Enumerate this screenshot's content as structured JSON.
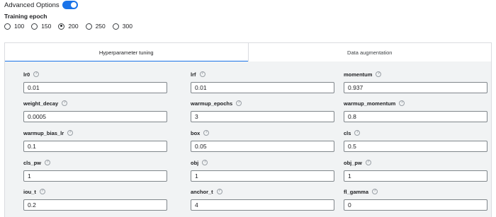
{
  "advanced": {
    "label": "Advanced Options",
    "enabled": true
  },
  "epoch": {
    "title": "Training epoch",
    "options": [
      "100",
      "150",
      "200",
      "250",
      "300"
    ],
    "selected": "200"
  },
  "tabs": [
    {
      "label": "Hyperparameter tuning",
      "active": true
    },
    {
      "label": "Data augmentation",
      "active": false
    }
  ],
  "help_glyph": "?",
  "fields": [
    {
      "label": "lr0",
      "value": "0.01"
    },
    {
      "label": "lrf",
      "value": "0.01"
    },
    {
      "label": "momentum",
      "value": "0.937"
    },
    {
      "label": "weight_decay",
      "value": "0.0005"
    },
    {
      "label": "warmup_epochs",
      "value": "3"
    },
    {
      "label": "warmup_momentum",
      "value": "0.8"
    },
    {
      "label": "warmup_bias_lr",
      "value": "0.1"
    },
    {
      "label": "box",
      "value": "0.05"
    },
    {
      "label": "cls",
      "value": "0.5"
    },
    {
      "label": "cls_pw",
      "value": "1"
    },
    {
      "label": "obj",
      "value": "1"
    },
    {
      "label": "obj_pw",
      "value": "1"
    },
    {
      "label": "iou_t",
      "value": "0.2"
    },
    {
      "label": "anchor_t",
      "value": "4"
    },
    {
      "label": "fl_gamma",
      "value": "0"
    }
  ],
  "colors": {
    "accent": "#1a73e8",
    "panel_bg": "#f1f3f4"
  }
}
